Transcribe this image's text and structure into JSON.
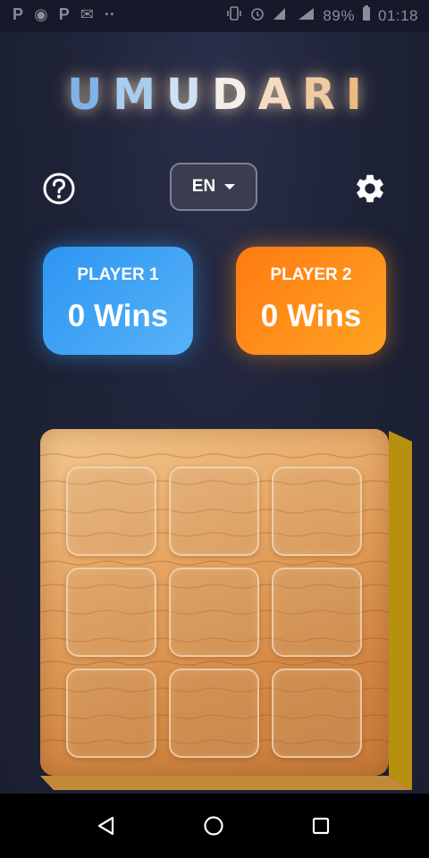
{
  "status_bar": {
    "left_glyphs": [
      "P",
      "◉",
      "P",
      "✉",
      "··"
    ],
    "battery": "89%",
    "time": "01:18"
  },
  "app": {
    "title_letters": [
      "U",
      "M",
      "U",
      "D",
      "A",
      "R",
      "I"
    ],
    "title_colors": [
      "#7fb4ea",
      "#a7cdef",
      "#cfe2f5",
      "#f3efe8",
      "#f5dcc0",
      "#f2caa0",
      "#efb982"
    ],
    "help_icon": "help-circle-icon",
    "settings_icon": "gear-icon",
    "language": {
      "selected": "EN",
      "icon": "caret-down-icon"
    },
    "players": [
      {
        "name": "PLAYER 1",
        "score": "0 Wins",
        "color": "#3a9ff3"
      },
      {
        "name": "PLAYER 2",
        "score": "0 Wins",
        "color": "#ff8a16"
      }
    ],
    "board": {
      "rows": 3,
      "cols": 3,
      "cells": [
        "",
        "",
        "",
        "",
        "",
        "",
        "",
        "",
        ""
      ],
      "color": "#e3a262"
    }
  },
  "nav_bar": {
    "back_icon": "back-triangle-icon",
    "home_icon": "home-circle-icon",
    "recent_icon": "recent-square-icon"
  }
}
